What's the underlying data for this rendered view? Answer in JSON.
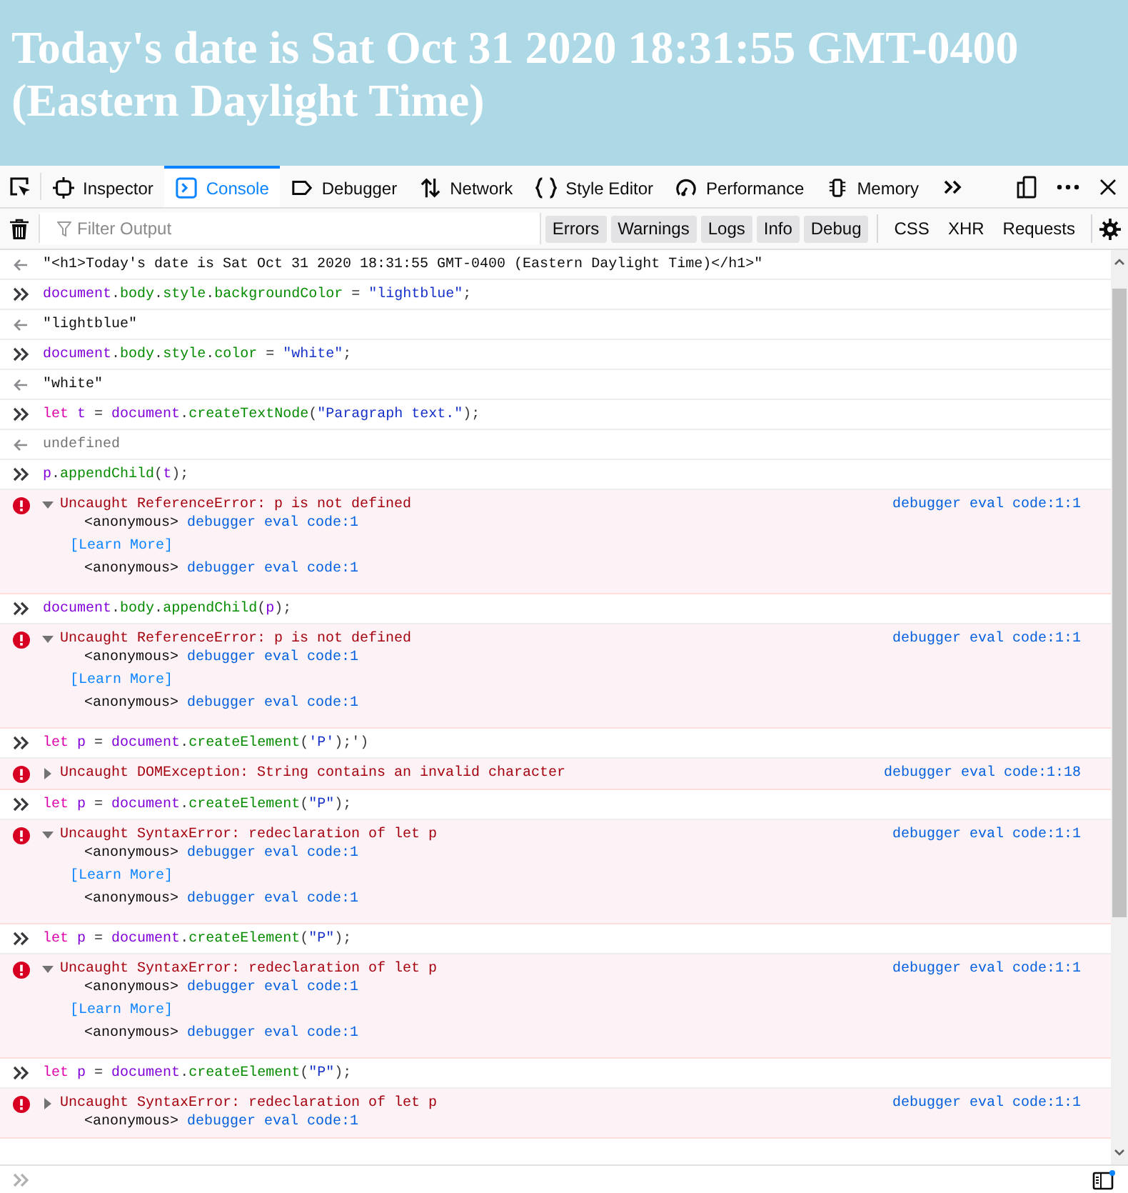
{
  "page_heading": "Today's date is Sat Oct 31 2020 18:31:55 GMT-0400 (Eastern Daylight Time)",
  "tabs": [
    {
      "label": "Inspector",
      "selected": false
    },
    {
      "label": "Console",
      "selected": true
    },
    {
      "label": "Debugger",
      "selected": false
    },
    {
      "label": "Network",
      "selected": false
    },
    {
      "label": "Style Editor",
      "selected": false
    },
    {
      "label": "Performance",
      "selected": false
    },
    {
      "label": "Memory",
      "selected": false
    }
  ],
  "filter": {
    "placeholder": "Filter Output"
  },
  "level_filters": [
    {
      "label": "Errors",
      "selected": true
    },
    {
      "label": "Warnings",
      "selected": true
    },
    {
      "label": "Logs",
      "selected": true
    },
    {
      "label": "Info",
      "selected": true
    },
    {
      "label": "Debug",
      "selected": true
    }
  ],
  "type_filters": [
    {
      "label": "CSS",
      "selected": false
    },
    {
      "label": "XHR",
      "selected": false
    },
    {
      "label": "Requests",
      "selected": false
    }
  ],
  "messages": [
    {
      "kind": "result",
      "muted": false,
      "text": "\"<h1>Today's date is Sat Oct 31 2020 18:31:55 GMT-0400 (Eastern Daylight Time)</h1>\""
    },
    {
      "kind": "input",
      "tokens": [
        {
          "kind": "var",
          "text": "document"
        },
        {
          "kind": "punct",
          "text": "."
        },
        {
          "kind": "prop",
          "text": "body"
        },
        {
          "kind": "punct",
          "text": "."
        },
        {
          "kind": "prop",
          "text": "style"
        },
        {
          "kind": "punct",
          "text": "."
        },
        {
          "kind": "prop",
          "text": "backgroundColor"
        },
        {
          "kind": "punct",
          "text": " = "
        },
        {
          "kind": "string",
          "text": "\"lightblue\""
        },
        {
          "kind": "punct",
          "text": ";"
        }
      ]
    },
    {
      "kind": "result",
      "muted": false,
      "text": "\"lightblue\""
    },
    {
      "kind": "input",
      "tokens": [
        {
          "kind": "var",
          "text": "document"
        },
        {
          "kind": "punct",
          "text": "."
        },
        {
          "kind": "prop",
          "text": "body"
        },
        {
          "kind": "punct",
          "text": "."
        },
        {
          "kind": "prop",
          "text": "style"
        },
        {
          "kind": "punct",
          "text": "."
        },
        {
          "kind": "prop",
          "text": "color"
        },
        {
          "kind": "punct",
          "text": " = "
        },
        {
          "kind": "string",
          "text": "\"white\""
        },
        {
          "kind": "punct",
          "text": ";"
        }
      ]
    },
    {
      "kind": "result",
      "muted": false,
      "text": "\"white\""
    },
    {
      "kind": "input",
      "tokens": [
        {
          "kind": "keyword",
          "text": "let"
        },
        {
          "kind": "var",
          "text": "t"
        },
        {
          "kind": "punct",
          "text": " = "
        },
        {
          "kind": "var",
          "text": "document"
        },
        {
          "kind": "punct",
          "text": "."
        },
        {
          "kind": "prop",
          "text": "createTextNode"
        },
        {
          "kind": "punct",
          "text": "("
        },
        {
          "kind": "string",
          "text": "\"Paragraph text.\""
        },
        {
          "kind": "punct",
          "text": ");"
        }
      ]
    },
    {
      "kind": "result",
      "muted": true,
      "text": "undefined"
    },
    {
      "kind": "input",
      "tokens": [
        {
          "kind": "var",
          "text": "p"
        },
        {
          "kind": "punct",
          "text": "."
        },
        {
          "kind": "prop",
          "text": "appendChild"
        },
        {
          "kind": "punct",
          "text": "("
        },
        {
          "kind": "var",
          "text": "t"
        },
        {
          "kind": "punct",
          "text": ");"
        }
      ]
    },
    {
      "kind": "error",
      "expanded": true,
      "text": "Uncaught ReferenceError: p is not defined",
      "location": "debugger eval code:1:1",
      "details": [
        {
          "kind": "frame",
          "fn": "<anonymous>",
          "loc": "debugger eval code:1"
        },
        {
          "kind": "link",
          "text": "[Learn More]"
        },
        {
          "kind": "frame",
          "fn": "<anonymous>",
          "loc": "debugger eval code:1"
        }
      ]
    },
    {
      "kind": "input",
      "tokens": [
        {
          "kind": "var",
          "text": "document"
        },
        {
          "kind": "punct",
          "text": "."
        },
        {
          "kind": "prop",
          "text": "body"
        },
        {
          "kind": "punct",
          "text": "."
        },
        {
          "kind": "prop",
          "text": "appendChild"
        },
        {
          "kind": "punct",
          "text": "("
        },
        {
          "kind": "var",
          "text": "p"
        },
        {
          "kind": "punct",
          "text": ");"
        }
      ]
    },
    {
      "kind": "error",
      "expanded": true,
      "text": "Uncaught ReferenceError: p is not defined",
      "location": "debugger eval code:1:1",
      "details": [
        {
          "kind": "frame",
          "fn": "<anonymous>",
          "loc": "debugger eval code:1"
        },
        {
          "kind": "link",
          "text": "[Learn More]"
        },
        {
          "kind": "frame",
          "fn": "<anonymous>",
          "loc": "debugger eval code:1"
        }
      ]
    },
    {
      "kind": "input",
      "tokens": [
        {
          "kind": "keyword",
          "text": "let"
        },
        {
          "kind": "var",
          "text": "p"
        },
        {
          "kind": "punct",
          "text": " = "
        },
        {
          "kind": "var",
          "text": "document"
        },
        {
          "kind": "punct",
          "text": "."
        },
        {
          "kind": "prop",
          "text": "createElement"
        },
        {
          "kind": "punct",
          "text": "("
        },
        {
          "kind": "string",
          "text": "'P'"
        },
        {
          "kind": "punct",
          "text": ");')"
        }
      ]
    },
    {
      "kind": "error",
      "expanded": false,
      "text": "Uncaught DOMException: String contains an invalid character",
      "location": "debugger eval code:1:18"
    },
    {
      "kind": "input",
      "tokens": [
        {
          "kind": "keyword",
          "text": "let"
        },
        {
          "kind": "var",
          "text": "p"
        },
        {
          "kind": "punct",
          "text": " = "
        },
        {
          "kind": "var",
          "text": "document"
        },
        {
          "kind": "punct",
          "text": "."
        },
        {
          "kind": "prop",
          "text": "createElement"
        },
        {
          "kind": "punct",
          "text": "("
        },
        {
          "kind": "string",
          "text": "\"P\""
        },
        {
          "kind": "punct",
          "text": ");"
        }
      ]
    },
    {
      "kind": "error",
      "expanded": true,
      "text": "Uncaught SyntaxError: redeclaration of let p",
      "location": "debugger eval code:1:1",
      "details": [
        {
          "kind": "frame",
          "fn": "<anonymous>",
          "loc": "debugger eval code:1"
        },
        {
          "kind": "link",
          "text": "[Learn More]"
        },
        {
          "kind": "frame",
          "fn": "<anonymous>",
          "loc": "debugger eval code:1"
        }
      ]
    },
    {
      "kind": "input",
      "tokens": [
        {
          "kind": "keyword",
          "text": "let"
        },
        {
          "kind": "var",
          "text": "p"
        },
        {
          "kind": "punct",
          "text": " = "
        },
        {
          "kind": "var",
          "text": "document"
        },
        {
          "kind": "punct",
          "text": "."
        },
        {
          "kind": "prop",
          "text": "createElement"
        },
        {
          "kind": "punct",
          "text": "("
        },
        {
          "kind": "string",
          "text": "\"P\""
        },
        {
          "kind": "punct",
          "text": ");"
        }
      ]
    },
    {
      "kind": "error",
      "expanded": true,
      "text": "Uncaught SyntaxError: redeclaration of let p",
      "location": "debugger eval code:1:1",
      "details": [
        {
          "kind": "frame",
          "fn": "<anonymous>",
          "loc": "debugger eval code:1"
        },
        {
          "kind": "link",
          "text": "[Learn More]"
        },
        {
          "kind": "frame",
          "fn": "<anonymous>",
          "loc": "debugger eval code:1"
        }
      ]
    },
    {
      "kind": "input",
      "tokens": [
        {
          "kind": "keyword",
          "text": "let"
        },
        {
          "kind": "var",
          "text": "p"
        },
        {
          "kind": "punct",
          "text": " = "
        },
        {
          "kind": "var",
          "text": "document"
        },
        {
          "kind": "punct",
          "text": "."
        },
        {
          "kind": "prop",
          "text": "createElement"
        },
        {
          "kind": "punct",
          "text": "("
        },
        {
          "kind": "string",
          "text": "\"P\""
        },
        {
          "kind": "punct",
          "text": ");"
        }
      ]
    },
    {
      "kind": "error",
      "expanded": false,
      "text": "Uncaught SyntaxError: redeclaration of let p",
      "location": "debugger eval code:1:1",
      "details": [
        {
          "kind": "frame",
          "fn": "<anonymous>",
          "loc": "debugger eval code:1"
        }
      ]
    }
  ]
}
